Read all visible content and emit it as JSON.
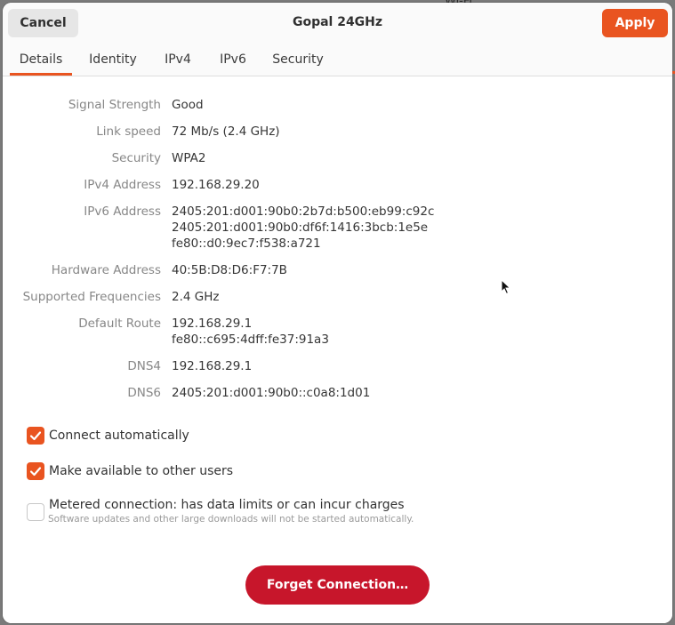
{
  "background": {
    "peek_text": "Wi-Fi"
  },
  "header": {
    "title": "Gopal 24GHz",
    "cancel_label": "Cancel",
    "apply_label": "Apply"
  },
  "tabs": [
    {
      "label": "Details",
      "active": true
    },
    {
      "label": "Identity",
      "active": false
    },
    {
      "label": "IPv4",
      "active": false
    },
    {
      "label": "IPv6",
      "active": false
    },
    {
      "label": "Security",
      "active": false
    }
  ],
  "details": [
    {
      "label": "Signal Strength",
      "value": "Good"
    },
    {
      "label": "Link speed",
      "value": "72 Mb/s (2.4 GHz)"
    },
    {
      "label": "Security",
      "value": "WPA2"
    },
    {
      "label": "IPv4 Address",
      "value": "192.168.29.20"
    },
    {
      "label": "IPv6 Address",
      "values": [
        "2405:201:d001:90b0:2b7d:b500:eb99:c92c",
        "2405:201:d001:90b0:df6f:1416:3bcb:1e5e",
        "fe80::d0:9ec7:f538:a721"
      ]
    },
    {
      "label": "Hardware Address",
      "value": "40:5B:D8:D6:F7:7B"
    },
    {
      "label": "Supported Frequencies",
      "value": "2.4 GHz"
    },
    {
      "label": "Default Route",
      "values": [
        "192.168.29.1",
        "fe80::c695:4dff:fe37:91a3"
      ]
    },
    {
      "label": "DNS4",
      "value": "192.168.29.1"
    },
    {
      "label": "DNS6",
      "value": "2405:201:d001:90b0::c0a8:1d01"
    }
  ],
  "options": {
    "connect_automatically": {
      "label": "Connect automatically",
      "checked": true
    },
    "available_to_others": {
      "label": "Make available to other users",
      "checked": true
    },
    "metered": {
      "label": "Metered connection: has data limits or can incur charges",
      "sublabel": "Software updates and other large downloads will not be started automatically.",
      "checked": false
    }
  },
  "forget_label": "Forget Connection…",
  "colors": {
    "accent": "#e95420",
    "destructive": "#c7162b"
  }
}
